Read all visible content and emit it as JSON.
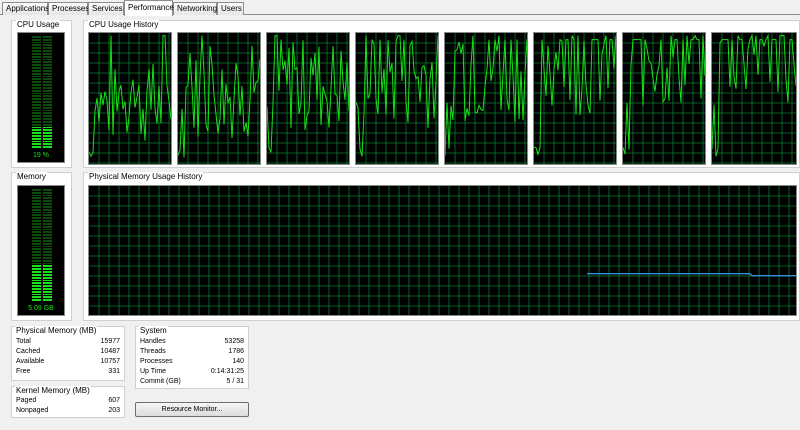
{
  "tabs": [
    {
      "label": "Applications",
      "active": false
    },
    {
      "label": "Processes",
      "active": false
    },
    {
      "label": "Services",
      "active": false
    },
    {
      "label": "Performance",
      "active": true
    },
    {
      "label": "Networking",
      "active": false
    },
    {
      "label": "Users",
      "active": false
    }
  ],
  "cpu_usage": {
    "title": "CPU Usage",
    "value_label": "19 %",
    "level": 0.19
  },
  "cpu_history": {
    "title": "CPU Usage History",
    "cores": 8
  },
  "memory": {
    "title": "Memory",
    "value_label": "5.09 GB",
    "level": 0.32
  },
  "memory_history": {
    "title": "Physical Memory Usage History"
  },
  "physical_memory": {
    "title": "Physical Memory (MB)",
    "rows": [
      {
        "label": "Total",
        "value": "15977"
      },
      {
        "label": "Cached",
        "value": "10487"
      },
      {
        "label": "Available",
        "value": "10757"
      },
      {
        "label": "Free",
        "value": "331"
      }
    ]
  },
  "kernel_memory": {
    "title": "Kernel Memory (MB)",
    "rows": [
      {
        "label": "Paged",
        "value": "607"
      },
      {
        "label": "Nonpaged",
        "value": "203"
      }
    ]
  },
  "system": {
    "title": "System",
    "rows": [
      {
        "label": "Handles",
        "value": "53258"
      },
      {
        "label": "Threads",
        "value": "1786"
      },
      {
        "label": "Processes",
        "value": "140"
      },
      {
        "label": "Up Time",
        "value": "0:14:31:25"
      },
      {
        "label": "Commit (GB)",
        "value": "5 / 31"
      }
    ]
  },
  "resource_monitor_button": "Resource Monitor...",
  "colors": {
    "graph_bg": "#000000",
    "grid": "#0a7a2e",
    "cpu_line": "#19e019",
    "mem_line": "#2f8fe0"
  }
}
